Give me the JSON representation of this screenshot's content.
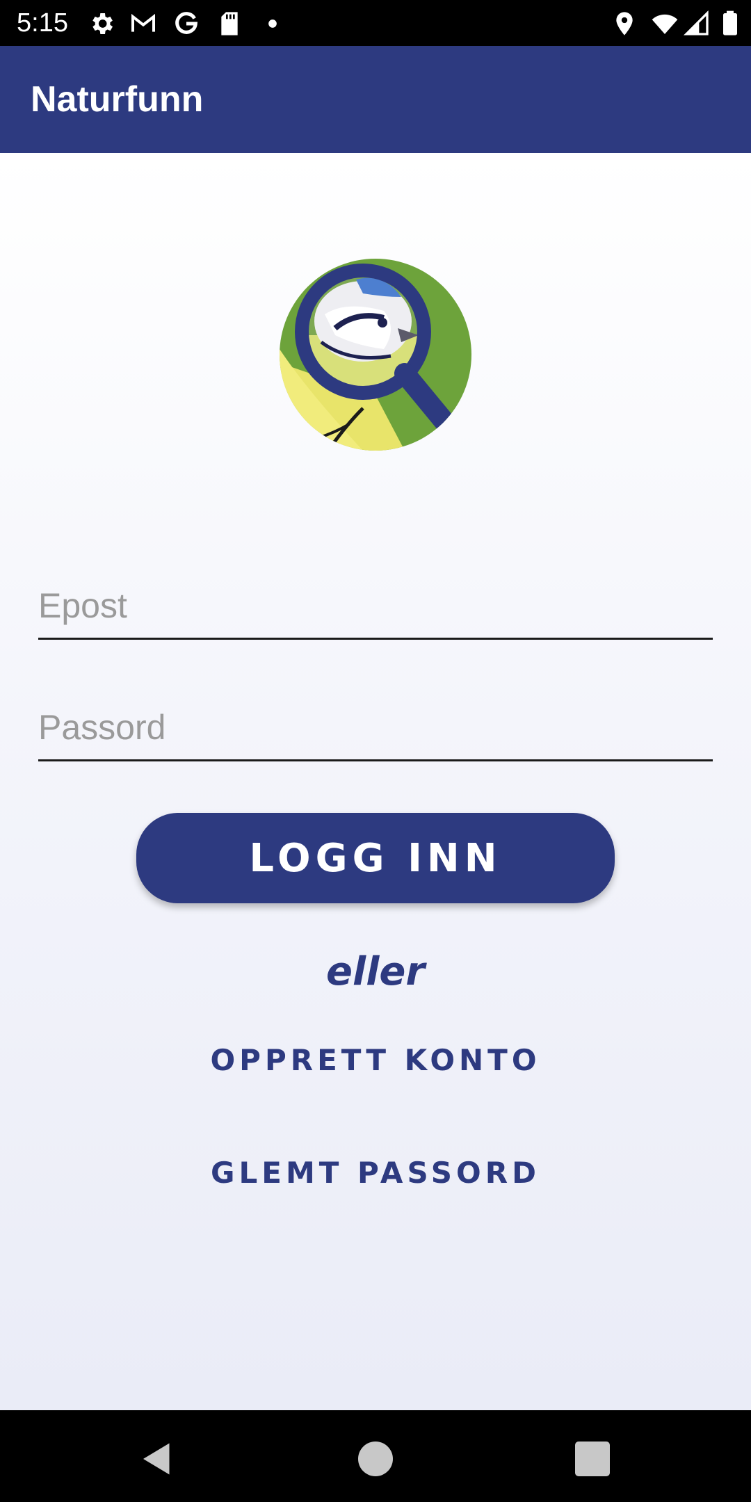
{
  "status_bar": {
    "time": "5:15",
    "icons_left": [
      "gear-icon",
      "gmail-icon",
      "google-icon",
      "sd-card-icon",
      "dot-icon"
    ],
    "icons_right": [
      "location-icon",
      "wifi-icon",
      "signal-icon",
      "battery-icon"
    ]
  },
  "app_bar": {
    "title": "Naturfunn",
    "color": "#2d3a80"
  },
  "login": {
    "email_placeholder": "Epost",
    "password_placeholder": "Passord",
    "login_label": "LOGG INN",
    "or_text": "eller",
    "create_account_label": "OPPRETT KONTO",
    "forgot_password_label": "GLEMT PASSORD"
  },
  "navigation": {
    "buttons": [
      "back-icon",
      "home-icon",
      "recents-icon"
    ]
  },
  "colors": {
    "accent": "#2d3a80",
    "text_hint": "#9a9a9a"
  }
}
